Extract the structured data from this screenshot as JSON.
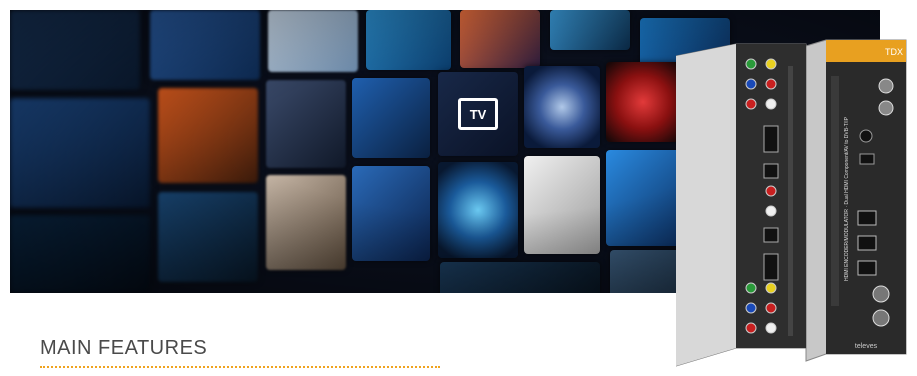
{
  "banner": {
    "screen_icon_text": "TV",
    "colors": {
      "background": "#0a0f1c",
      "accent": "#f0a31e"
    }
  },
  "device": {
    "brand_logo": "TDX",
    "brand_name": "televes",
    "side_label": "HDMI ENCODER/MODULATOR · Dual HDMI Component/AV to DVB-T/IP"
  },
  "section": {
    "title": "MAIN FEATURES"
  }
}
